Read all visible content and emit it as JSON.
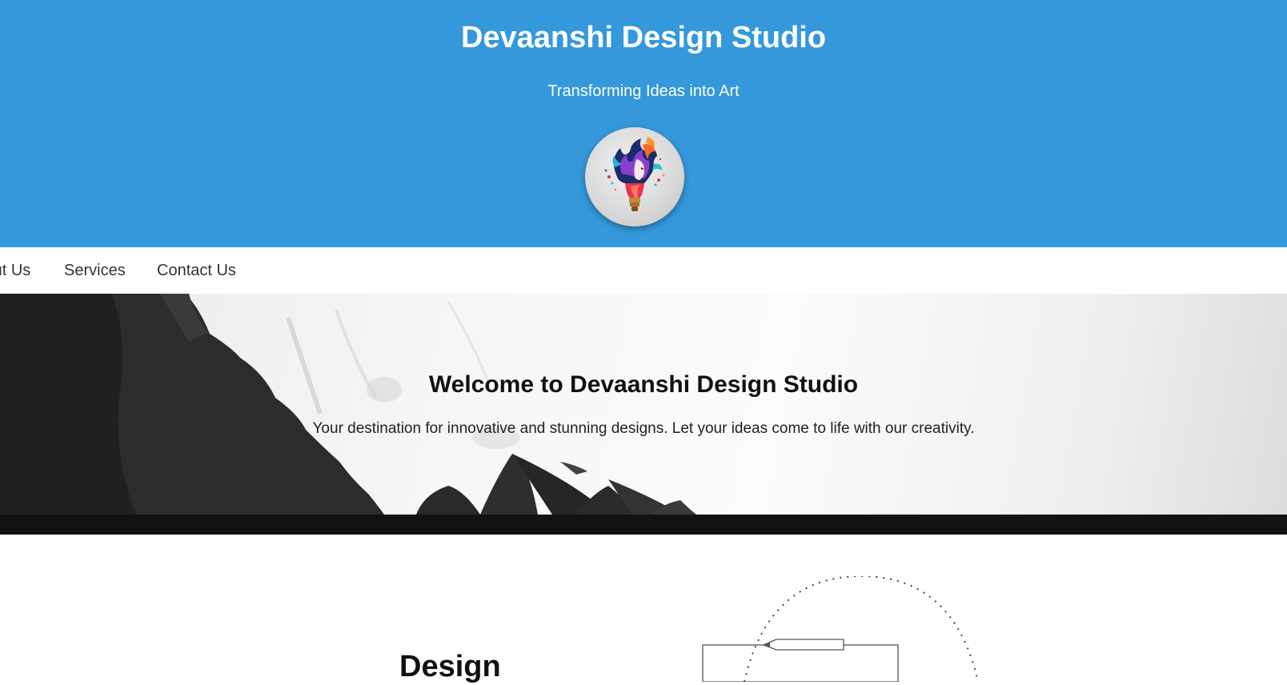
{
  "header": {
    "title": "Devaanshi Design Studio",
    "tagline": "Transforming Ideas into Art",
    "logo_icon": "lightbulb-woman-logo",
    "background_color": "#3498db"
  },
  "nav": {
    "items": [
      {
        "label": "About Us"
      },
      {
        "label": "Services"
      },
      {
        "label": "Contact Us"
      }
    ]
  },
  "hero": {
    "title": "Welcome to Devaanshi Design Studio",
    "text": "Your destination for innovative and stunning designs. Let your ideas come to life with our creativity."
  },
  "section": {
    "heading": "Design",
    "illustration_icon": "design-tools-illustration"
  }
}
